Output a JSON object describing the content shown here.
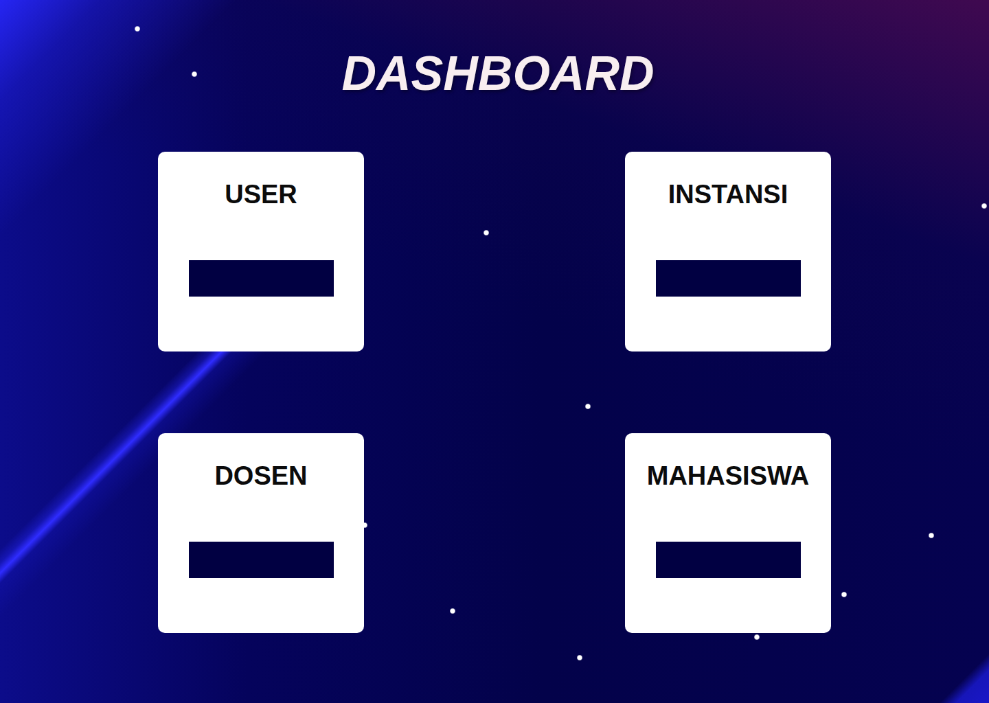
{
  "title": "DASHBOARD",
  "cards": [
    {
      "label": "USER"
    },
    {
      "label": "INSTANSI"
    },
    {
      "label": "DOSEN"
    },
    {
      "label": "MAHASISWA"
    }
  ]
}
